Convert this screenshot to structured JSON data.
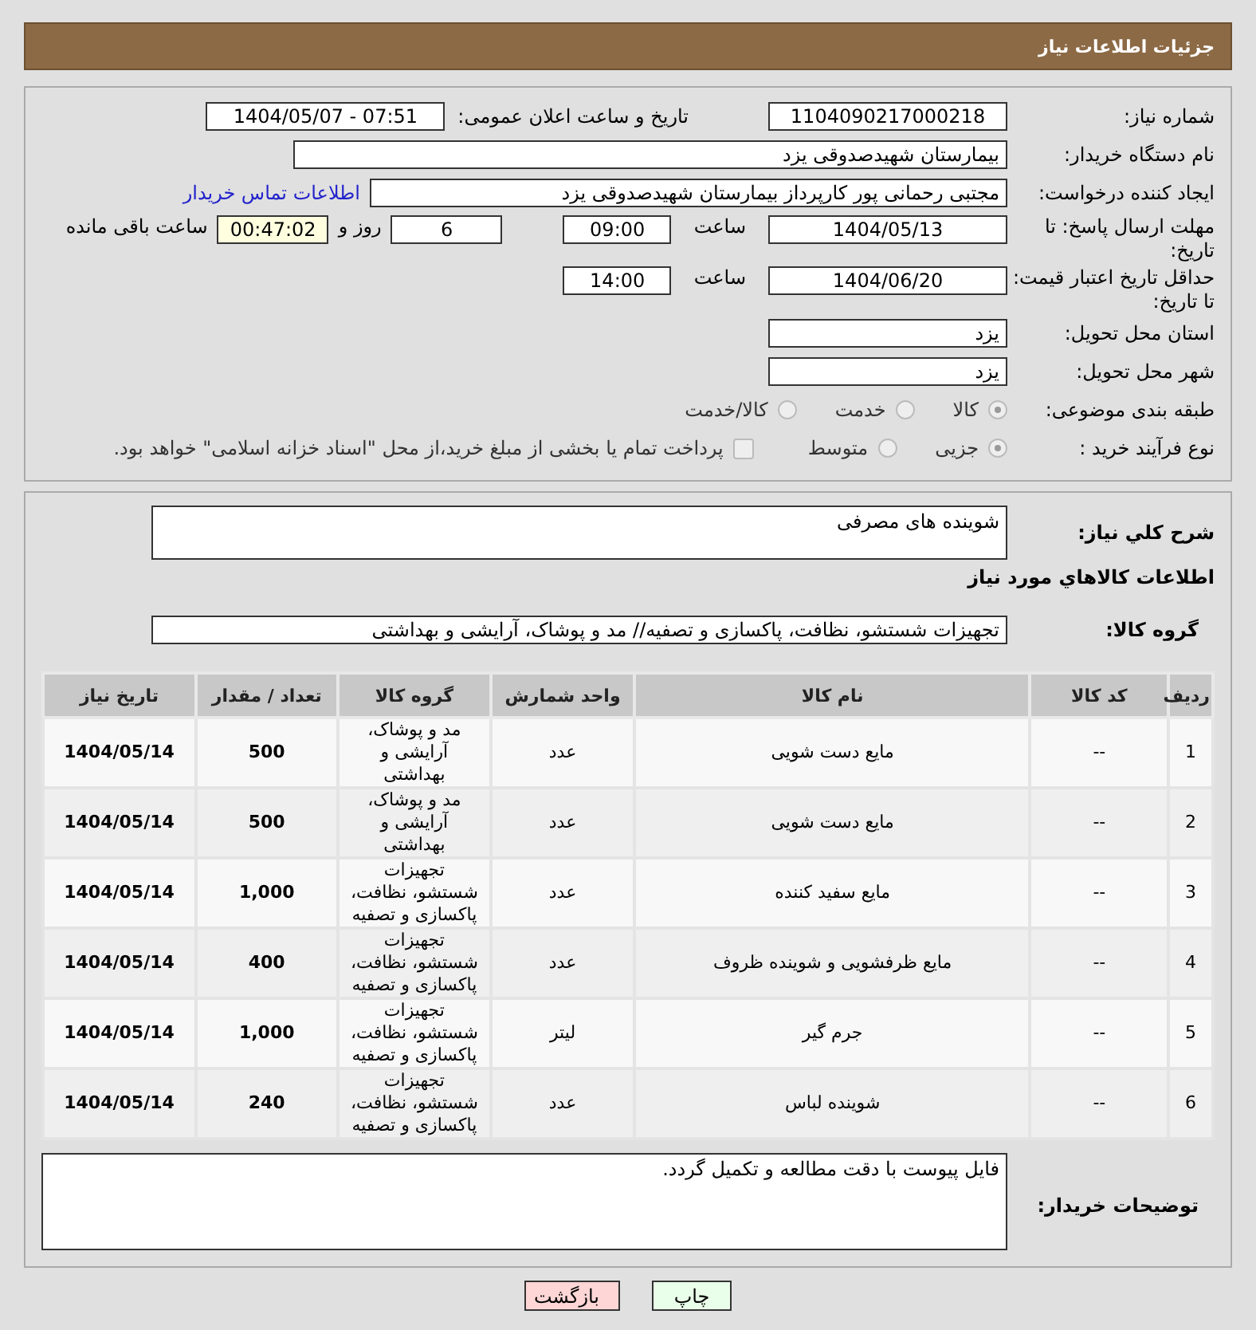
{
  "header": {
    "title": "جزئیات اطلاعات نیاز"
  },
  "need_number": {
    "label": "شماره نیاز:",
    "value": "1104090217000218"
  },
  "announce": {
    "label": "تاریخ و ساعت اعلان عمومی:",
    "value": "1404/05/07 - 07:51"
  },
  "buyer": {
    "label": "نام دستگاه خریدار:",
    "value": "بیمارستان شهیدصدوقی یزد"
  },
  "creator": {
    "label": "ایجاد کننده درخواست:",
    "value": "مجتبی رحمانی پور کارپرداز بیمارستان شهیدصدوقی یزد",
    "link": "اطلاعات تماس خریدار"
  },
  "deadline": {
    "label": "مهلت ارسال پاسخ: تا تاریخ:",
    "date": "1404/05/13",
    "time_label": "ساعت",
    "time": "09:00",
    "days": "6",
    "days_label": "روز و",
    "remaining": "00:47:02",
    "remaining_label": "ساعت باقی مانده"
  },
  "validity": {
    "label": "حداقل تاریخ اعتبار قیمت: تا تاریخ:",
    "date": "1404/06/20",
    "time_label": "ساعت",
    "time": "14:00"
  },
  "province": {
    "label": "استان محل تحویل:",
    "value": "یزد"
  },
  "city": {
    "label": "شهر محل تحویل:",
    "value": "یزد"
  },
  "category": {
    "label": "طبقه بندی موضوعی:",
    "options": [
      {
        "label": "کالا",
        "selected": true
      },
      {
        "label": "خدمت",
        "selected": false
      },
      {
        "label": "کالا/خدمت",
        "selected": false
      }
    ]
  },
  "purchase_type": {
    "label": "نوع فرآیند خرید :",
    "options": [
      {
        "label": "جزیی",
        "selected": true
      },
      {
        "label": "متوسط",
        "selected": false
      }
    ],
    "payment_note": {
      "label": "پرداخت تمام یا بخشی از مبلغ خرید،از محل \"اسناد خزانه اسلامی\" خواهد بود.",
      "checked": false
    }
  },
  "description": {
    "label": "شرح کلي نياز:",
    "value": "شوینده های مصرفی"
  },
  "goods_title": "اطلاعات کالاهاي مورد نياز",
  "goods_group": {
    "label": "گروه کالا:",
    "value": "تجهیزات شستشو، نظافت، پاکسازی و تصفیه// مد و پوشاک، آرایشی و بهداشتی"
  },
  "table": {
    "columns": [
      "ردیف",
      "کد کالا",
      "نام کالا",
      "واحد شمارش",
      "گروه کالا",
      "تعداد / مقدار",
      "تاریخ نیاز"
    ],
    "rows": [
      [
        "1",
        "--",
        "مایع دست شویی",
        "عدد",
        "مد و پوشاک، آرایشی و بهداشتی",
        "500",
        "1404/05/14"
      ],
      [
        "2",
        "--",
        "مایع دست شویی",
        "عدد",
        "مد و پوشاک، آرایشی و بهداشتی",
        "500",
        "1404/05/14"
      ],
      [
        "3",
        "--",
        "مایع سفید کننده",
        "عدد",
        "تجهیزات شستشو، نظافت، پاکسازی و تصفیه",
        "1,000",
        "1404/05/14"
      ],
      [
        "4",
        "--",
        "مایع ظرفشویی و شوینده ظروف",
        "عدد",
        "تجهیزات شستشو، نظافت، پاکسازی و تصفیه",
        "400",
        "1404/05/14"
      ],
      [
        "5",
        "--",
        "جرم گیر",
        "لیتر",
        "تجهیزات شستشو، نظافت، پاکسازی و تصفیه",
        "1,000",
        "1404/05/14"
      ],
      [
        "6",
        "--",
        "شوینده لباس",
        "عدد",
        "تجهیزات شستشو، نظافت، پاکسازی و تصفیه",
        "240",
        "1404/05/14"
      ]
    ]
  },
  "buyer_notes": {
    "label": "توضیحات خریدار:",
    "value": "فایل پیوست با دقت مطالعه و تکمیل گردد."
  },
  "buttons": [
    {
      "label": "چاپ",
      "kind": "print"
    },
    {
      "label": "بازگشت",
      "kind": "back"
    }
  ]
}
